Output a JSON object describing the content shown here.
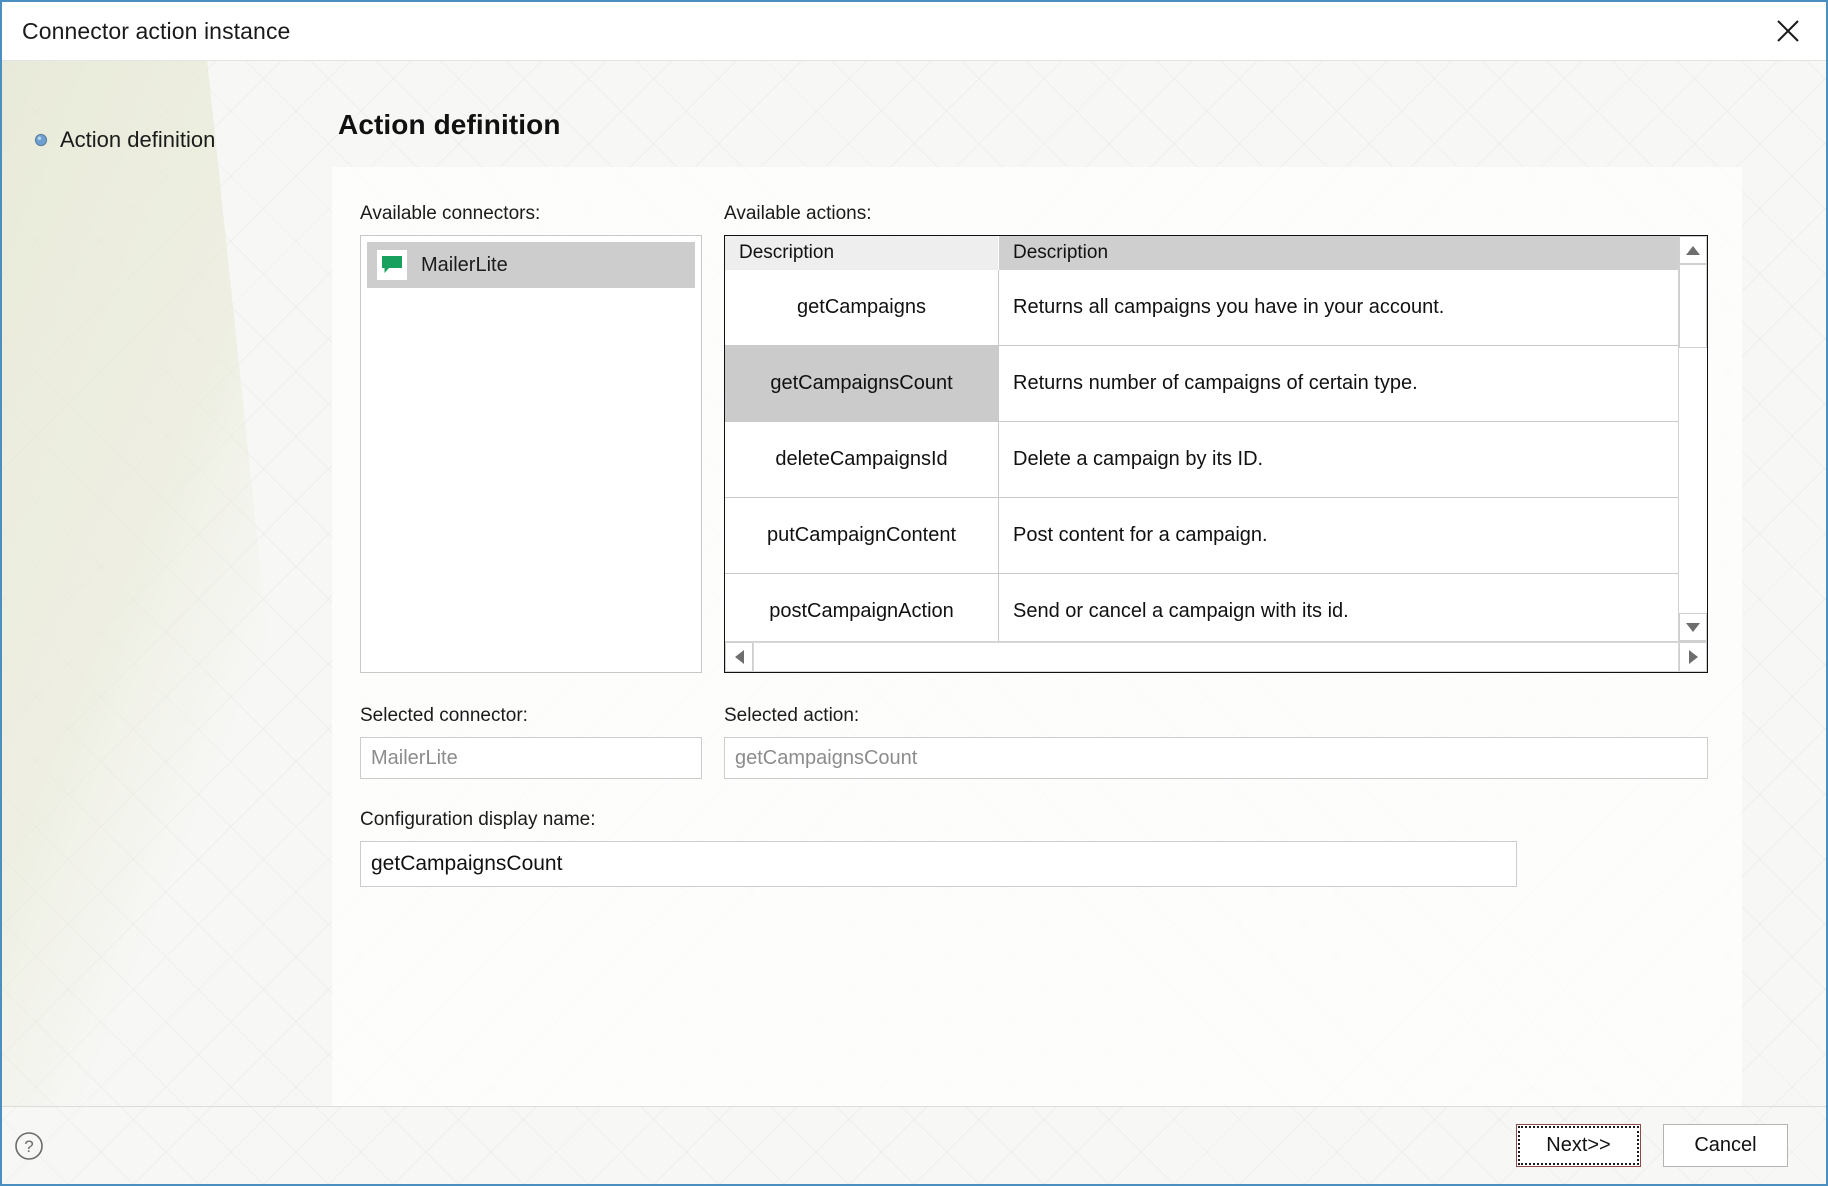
{
  "window": {
    "title": "Connector action instance",
    "close_icon": "close-icon",
    "accent_border": "#4a8fbf"
  },
  "sidebar": {
    "items": [
      {
        "label": "Action definition",
        "icon": "blue-diamond-bullet-icon",
        "active": true
      }
    ]
  },
  "main": {
    "page_title": "Action definition",
    "connectors": {
      "label": "Available connectors:",
      "items": [
        {
          "name": "MailerLite",
          "icon": "green-speech-bubble-icon",
          "selected": true
        }
      ]
    },
    "actions": {
      "label": "Available actions:",
      "columns": [
        "Description",
        "Description"
      ],
      "rows": [
        {
          "name": "getCampaigns",
          "description": "Returns all campaigns you have in your account.",
          "selected": false
        },
        {
          "name": "getCampaignsCount",
          "description": "Returns number of campaigns of certain type.",
          "selected": true
        },
        {
          "name": "deleteCampaignsId",
          "description": "Delete a campaign by its ID.",
          "selected": false
        },
        {
          "name": "putCampaignContent",
          "description": "Post content for a campaign.",
          "selected": false
        },
        {
          "name": "postCampaignAction",
          "description": "Send or cancel a campaign with its id.",
          "selected": false
        }
      ],
      "scroll_up_icon": "triangle-up-icon",
      "scroll_down_icon": "triangle-down-icon",
      "scroll_left_icon": "triangle-left-icon",
      "scroll_right_icon": "triangle-right-icon"
    },
    "selected_connector": {
      "label": "Selected connector:",
      "value": "MailerLite"
    },
    "selected_action": {
      "label": "Selected action:",
      "value": "getCampaignsCount"
    },
    "display_name": {
      "label": "Configuration display name:",
      "value": "getCampaignsCount"
    }
  },
  "footer": {
    "help_icon": "question-mark-circle-icon",
    "next_label": "Next>>",
    "cancel_label": "Cancel"
  }
}
